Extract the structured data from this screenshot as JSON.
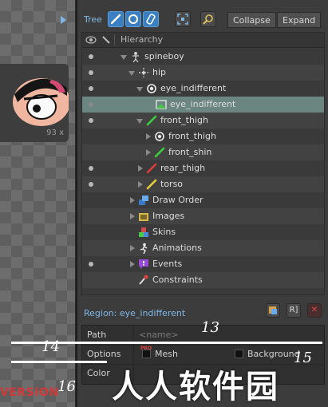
{
  "viewport": {
    "thumbnail_size_label": "93 x",
    "version_text": "VERSION"
  },
  "toolbar": {
    "title": "Tree",
    "collapse_label": "Collapse",
    "expand_label": "Expand"
  },
  "tree": {
    "header_label": "Hierarchy",
    "rows": [
      {
        "label": "spineboy",
        "icon": "skeleton-icon"
      },
      {
        "label": "hip",
        "icon": "bone-icon"
      },
      {
        "label": "eye_indifferent",
        "icon": "slot-icon"
      },
      {
        "label": "eye_indifferent",
        "icon": "region-attachment-icon"
      },
      {
        "label": "front_thigh",
        "icon": "bone-green-icon"
      },
      {
        "label": "front_thigh",
        "icon": "slot-icon"
      },
      {
        "label": "front_shin",
        "icon": "bone-green-icon"
      },
      {
        "label": "rear_thigh",
        "icon": "bone-red-icon"
      },
      {
        "label": "torso",
        "icon": "bone-yellow-icon"
      },
      {
        "label": "Draw Order",
        "icon": "draw-order-icon"
      },
      {
        "label": "Images",
        "icon": "images-folder-icon"
      },
      {
        "label": "Skins",
        "icon": "skins-icon"
      },
      {
        "label": "Animations",
        "icon": "animations-icon"
      },
      {
        "label": "Events",
        "icon": "events-icon"
      },
      {
        "label": "Constraints",
        "icon": "constraints-icon"
      }
    ]
  },
  "region": {
    "title": "Region: eye_indifferent",
    "path_label": "Path",
    "path_placeholder": "<name>",
    "options_label": "Options",
    "mesh_label": "Mesh",
    "pro_badge": "PRO",
    "background_label": "Background",
    "color_label": "Color"
  },
  "overlay": {
    "num_13": "13",
    "num_14": "14",
    "num_15": "15",
    "num_16": "16",
    "watermark": "人人软件园"
  },
  "colors": {
    "accent": "#7fb8e6",
    "selected_row": "#6b8580",
    "panel_bg": "#3c3c3c"
  }
}
